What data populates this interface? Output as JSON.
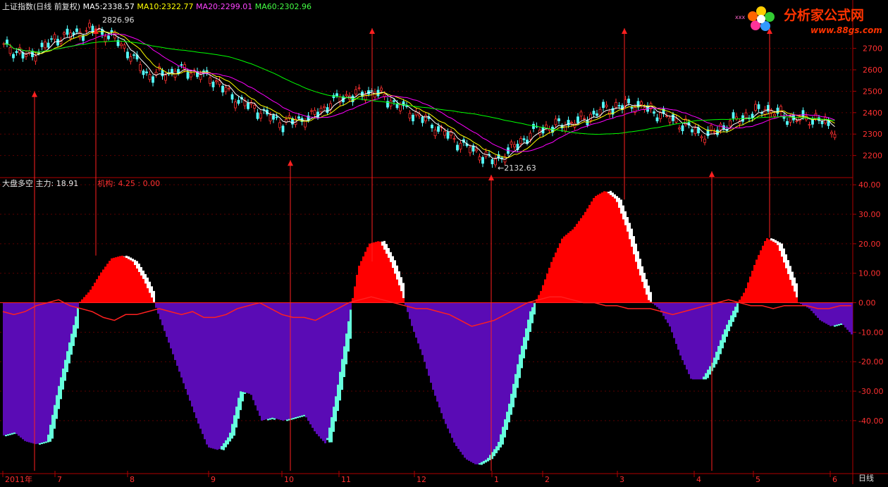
{
  "header": {
    "title": "上证指数(日线 前复权)",
    "ma5": {
      "label": "MA5:",
      "value": "2338.57",
      "color": "#ffffff"
    },
    "ma10": {
      "label": "MA10:",
      "value": "2322.77",
      "color": "#ffff00"
    },
    "ma20": {
      "label": "MA20:",
      "value": "2299.01",
      "color": "#ff00ff"
    },
    "ma60": {
      "label": "MA60:",
      "value": "2302.96",
      "color": "#00ff00"
    }
  },
  "brand": {
    "name": "分析家公式网",
    "url": "www.88gs.com"
  },
  "annotations": {
    "high": "2826.96",
    "low": "←2132.63"
  },
  "lower_header": {
    "name": "大盘多空",
    "main_label": "主力:",
    "main_value": "18.91",
    "inst_label": "机构:",
    "inst_value": "4.25 : 0.00"
  },
  "period_label": "日线",
  "chart_data": [
    {
      "type": "candlestick",
      "title": "上证指数(日线 前复权)",
      "y_ticks": [
        "2700",
        "2600",
        "2500",
        "2400",
        "2300",
        "2200"
      ],
      "ylim": [
        2110,
        2860
      ],
      "x_labels": [
        "2011年",
        "7",
        "8",
        "9",
        "10",
        "11",
        "12",
        "1",
        "2",
        "3",
        "4",
        "5",
        "6"
      ],
      "series": [
        {
          "name": "MA5",
          "color": "#ffffff"
        },
        {
          "name": "MA10",
          "color": "#ffff00"
        },
        {
          "name": "MA20",
          "color": "#ff00ff"
        },
        {
          "name": "MA60",
          "color": "#00ff00"
        }
      ],
      "high": {
        "value": 2826.96
      },
      "low": {
        "value": 2132.63
      }
    },
    {
      "type": "area",
      "title": "大盘多空",
      "y_ticks": [
        "40.00",
        "30.00",
        "20.00",
        "10.00",
        "0.00",
        "-10.00",
        "-20.00",
        "-30.00",
        "-40.00"
      ],
      "ylim": [
        -57,
        41
      ],
      "x_labels": [
        "2011年",
        "7",
        "8",
        "9",
        "10",
        "11",
        "12",
        "1",
        "2",
        "3",
        "4",
        "5",
        "6"
      ],
      "profile": [
        -45,
        -44,
        -47,
        -48,
        -47,
        -30,
        -15,
        0,
        4,
        10,
        15,
        16,
        14,
        8,
        0,
        -10,
        -20,
        -30,
        -40,
        -49,
        -50,
        -45,
        -30,
        -31,
        -40,
        -39,
        -40,
        -39,
        -38,
        -44,
        -48,
        -30,
        -8,
        12,
        20,
        21,
        14,
        4,
        -8,
        -18,
        -30,
        -40,
        -48,
        -53,
        -55,
        -53,
        -48,
        -35,
        -18,
        -3,
        4,
        14,
        22,
        25,
        30,
        36,
        38,
        35,
        25,
        12,
        1,
        -2,
        -8,
        -18,
        -26,
        -26,
        -20,
        -10,
        -2,
        4,
        14,
        22,
        20,
        10,
        0,
        -2,
        -6,
        -8,
        -7,
        -11
      ],
      "mainforce": [
        -3,
        -4,
        -3,
        -1,
        0,
        1,
        -1,
        -2,
        -3,
        -5,
        -6,
        -4,
        -4,
        -3,
        -2,
        -3,
        -4,
        -3,
        -5,
        -5,
        -4,
        -2,
        -1,
        0,
        -2,
        -4,
        -5,
        -5,
        -6,
        -4,
        -2,
        0,
        1,
        2,
        1,
        0,
        -1,
        -2,
        -2,
        -3,
        -4,
        -6,
        -8,
        -7,
        -6,
        -4,
        -2,
        0,
        1,
        2,
        2,
        1,
        0,
        0,
        -1,
        -1,
        -2,
        -2,
        -2,
        -3,
        -4,
        -3,
        -2,
        -1,
        0,
        1,
        0,
        -1,
        -1,
        -2,
        -1,
        -1,
        -1,
        -2,
        -2,
        -1,
        -1
      ]
    }
  ]
}
